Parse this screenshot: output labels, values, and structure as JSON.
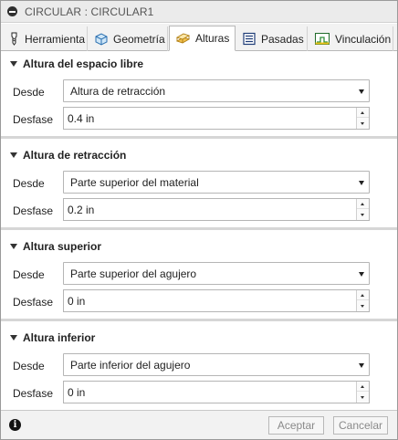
{
  "window": {
    "title": "CIRCULAR : CIRCULAR1"
  },
  "tabs": [
    {
      "label": "Herramienta",
      "icon": "tool-icon"
    },
    {
      "label": "Geometría",
      "icon": "geometry-icon"
    },
    {
      "label": "Alturas",
      "icon": "heights-icon",
      "active": true
    },
    {
      "label": "Pasadas",
      "icon": "passes-icon"
    },
    {
      "label": "Vinculación",
      "icon": "linking-icon"
    }
  ],
  "sections": [
    {
      "title": "Altura del espacio libre",
      "from_label": "Desde",
      "from_value": "Altura de retracción",
      "offset_label": "Desfase",
      "offset_value": "0.4 in"
    },
    {
      "title": "Altura de retracción",
      "from_label": "Desde",
      "from_value": "Parte superior del material",
      "offset_label": "Desfase",
      "offset_value": "0.2 in"
    },
    {
      "title": "Altura superior",
      "from_label": "Desde",
      "from_value": "Parte superior del agujero",
      "offset_label": "Desfase",
      "offset_value": "0 in"
    },
    {
      "title": "Altura inferior",
      "from_label": "Desde",
      "from_value": "Parte inferior del agujero",
      "offset_label": "Desfase",
      "offset_value": "0 in"
    }
  ],
  "footer": {
    "ok_label": "Aceptar",
    "cancel_label": "Cancelar"
  }
}
